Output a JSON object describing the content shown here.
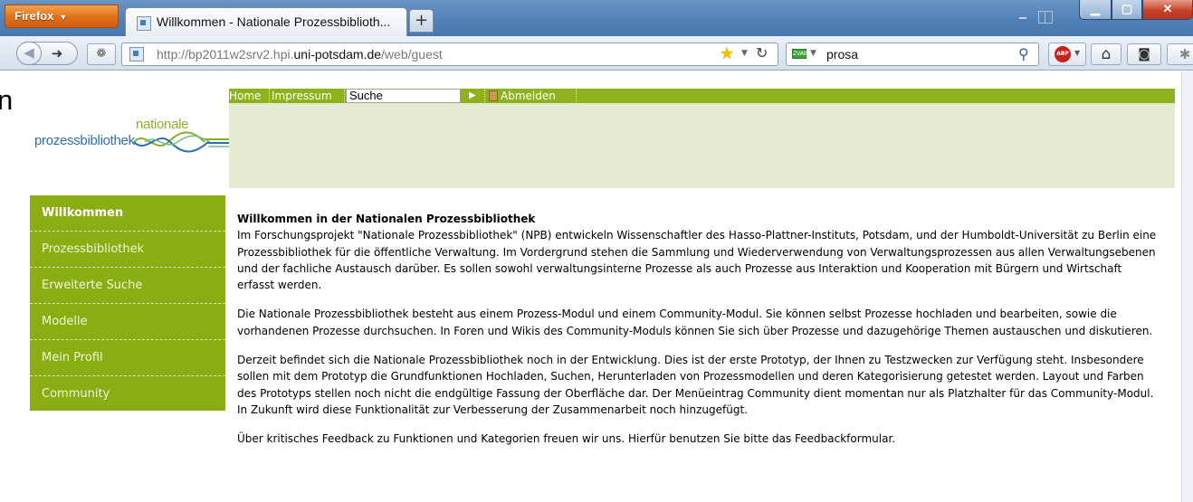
{
  "browser": {
    "firefox_button": "Firefox",
    "tab_title": "Willkommen - Nationale Prozessbiblioth...",
    "new_tab": "+",
    "url_prefix": "http://bp2011w2srv2.hpi.",
    "url_host": "uni-potsdam.de",
    "url_suffix": "/web/guest",
    "search_value": "prosa",
    "search_engine_label": "ZVAB"
  },
  "page": {
    "edge_letter": "n",
    "logo": {
      "line1": "nationale",
      "line2": "prozessbibliothek"
    },
    "topnav": {
      "home": "Home",
      "impressum": "Impressum",
      "search_value": "Suche",
      "search_go": "▶",
      "logout": "Abmelden"
    },
    "sidebar": {
      "items": [
        {
          "label": "Willkommen",
          "active": true
        },
        {
          "label": "Prozessbibliothek",
          "active": false
        },
        {
          "label": "Erweiterte Suche",
          "active": false
        },
        {
          "label": "Modelle",
          "active": false
        },
        {
          "label": "Mein Profil",
          "active": false
        },
        {
          "label": "Community",
          "active": false
        }
      ]
    },
    "content": {
      "title": "Willkommen in der Nationalen Prozessbibliothek",
      "paragraphs": [
        "Im Forschungsprojekt \"Nationale Prozessbibliothek\" (NPB) entwickeln Wissenschaftler des Hasso-Plattner-Instituts, Potsdam, und der Humboldt-Universität zu Berlin eine Prozessbibliothek für die öffentliche Verwaltung. Im Vordergrund stehen die Sammlung und Wiederverwendung von Verwaltungsprozessen aus allen Verwaltungsebenen und der fachliche Austausch darüber. Es sollen sowohl verwaltungsinterne Prozesse als auch Prozesse aus Interaktion und Kooperation mit Bürgern und Wirtschaft erfasst werden.",
        "Die Nationale Prozessbibliothek besteht aus einem Prozess-Modul und einem Community-Modul. Sie können selbst Prozesse hochladen und bearbeiten, sowie die vorhandenen Prozesse durchsuchen. In Foren und Wikis des Community-Moduls können Sie sich über Prozesse und dazugehörige Themen austauschen und diskutieren.",
        "Derzeit befindet sich die Nationale Prozessbibliothek noch in der Entwicklung. Dies ist der erste Prototyp, der Ihnen zu Testzwecken zur Verfügung steht. Insbesondere sollen mit dem Prototyp die Grundfunktionen Hochladen, Suchen, Herunterladen von Prozessmodellen und deren Kategorisierung getestet werden. Layout und Farben des Prototyps stellen noch nicht die endgültige Fassung der Oberfläche dar. Der Menüeintrag Community dient momentan nur als Platzhalter für das Community-Modul. In Zukunft wird diese Funktionalität zur Verbesserung der Zusammenarbeit noch hinzugefügt.",
        "Über kritisches Feedback zu Funktionen und Kategorien freuen wir uns. Hierfür benutzen Sie bitte das Feedbackformular."
      ]
    },
    "colors": {
      "accent_green": "#8bad14",
      "banner": "#e6ead3",
      "logo_green": "#8cae2a",
      "logo_blue": "#2d6fb1"
    }
  }
}
